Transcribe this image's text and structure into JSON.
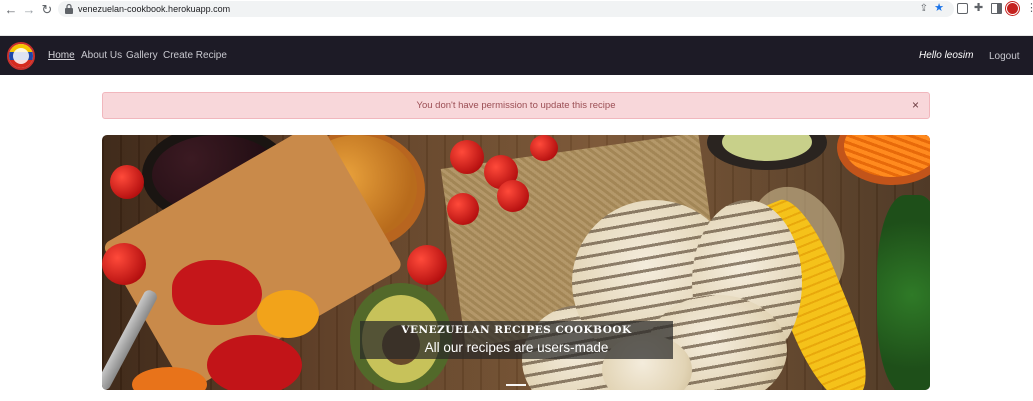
{
  "browser": {
    "url": "venezuelan-cookbook.herokuapp.com",
    "icons": [
      "back-icon",
      "forward-icon",
      "reload-icon",
      "lock-icon",
      "share-icon",
      "star-icon",
      "extension-icon",
      "puzzle-icon",
      "sidebar-icon",
      "profile-avatar",
      "more-icon"
    ]
  },
  "navbar": {
    "links": [
      {
        "label": "Home",
        "active": true
      },
      {
        "label": "About Us"
      },
      {
        "label": "Gallery"
      },
      {
        "label": "Create Recipe"
      }
    ],
    "greeting": "Hello leosim",
    "logout_label": "Logout"
  },
  "alert": {
    "message": "You don't have permission to update this recipe",
    "close_label": "×",
    "color": "#f8d7da"
  },
  "hero": {
    "caption_title": "VENEZUELAN RECIPES COOKBOOK",
    "caption_subtitle": "All our recipes are users-made"
  },
  "colors": {
    "navbar_bg": "#1d1b26",
    "alert_text": "#9b4e54"
  }
}
